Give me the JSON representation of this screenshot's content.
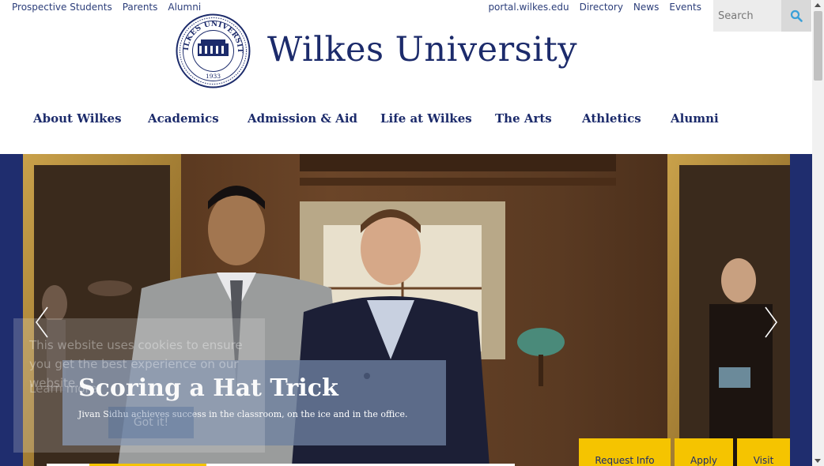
{
  "utility_nav": {
    "left": [
      "Prospective Students",
      "Parents",
      "Alumni"
    ],
    "right": [
      "portal.wilkes.edu",
      "Directory",
      "News",
      "Events"
    ]
  },
  "search": {
    "placeholder": "Search",
    "icon": "search-icon"
  },
  "brand": {
    "seal_text_top": "WILKES UNIVERSITY",
    "seal_year": "1933",
    "wordmark": "Wilkes University",
    "color": "#1c2b6b"
  },
  "main_nav": [
    "About Wilkes",
    "Academics",
    "Admission & Aid",
    "Life at Wilkes",
    "The Arts",
    "Athletics",
    "Alumni"
  ],
  "hero": {
    "title": "Scoring a Hat Trick",
    "subtitle": "Jivan Sidhu achieves success in the classroom, on the ice and in the office.",
    "background": "#1f2d6e"
  },
  "cookie_notice": {
    "text": "This website uses cookies to ensure you get the best experience on our website.",
    "link": "Learn more",
    "button": "Got it!"
  },
  "cta": {
    "request_info": "Request Info",
    "apply": "Apply",
    "visit": "Visit",
    "color": "#f5c400"
  },
  "colors": {
    "accent": "#f5c400",
    "brand": "#1c2b6b"
  }
}
